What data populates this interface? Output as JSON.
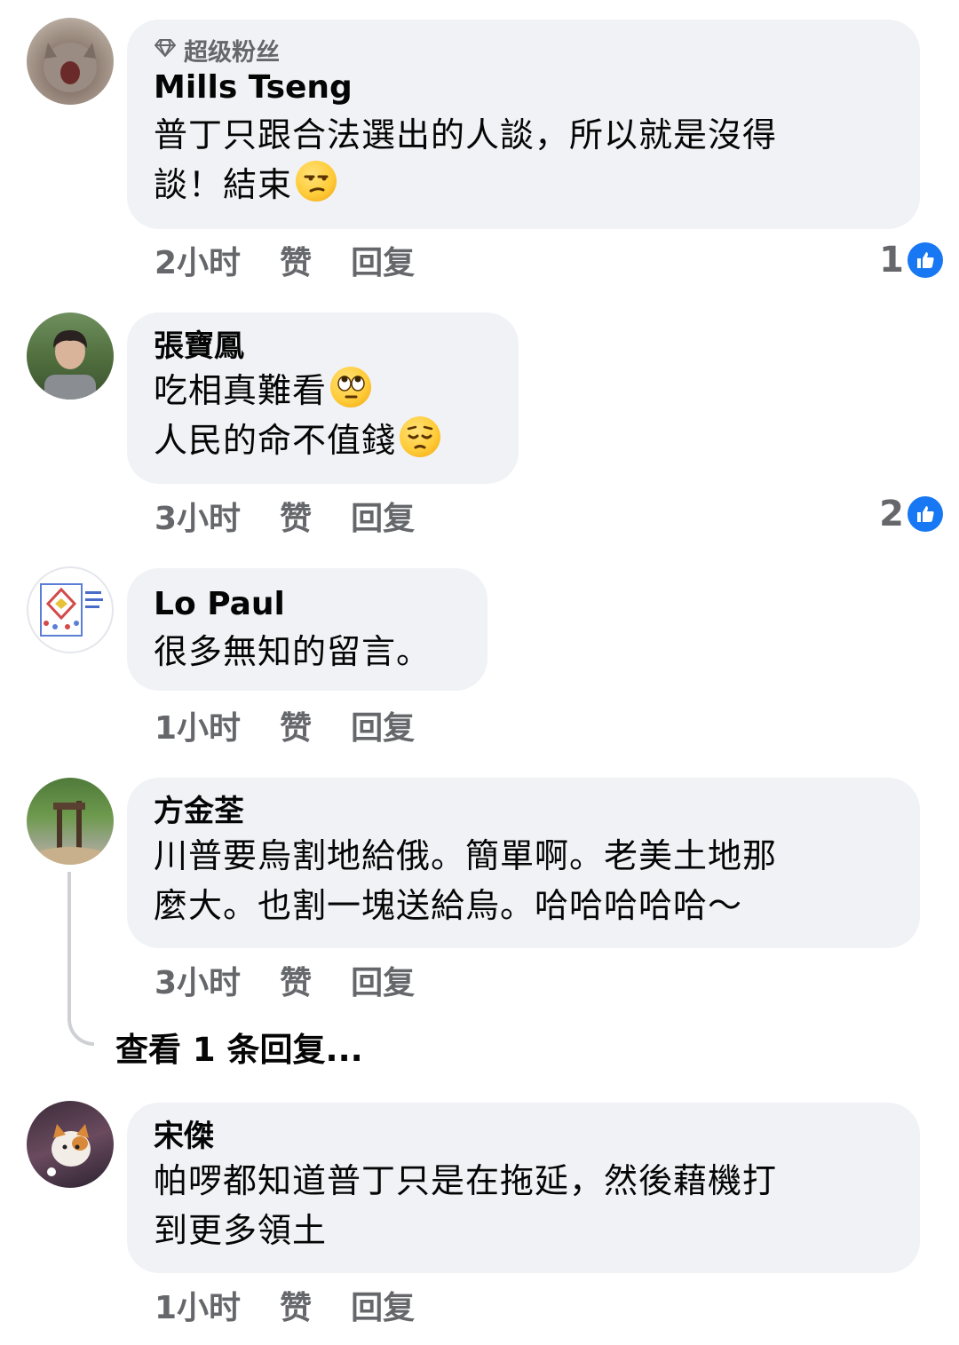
{
  "comments": [
    {
      "badge": "超级粉丝",
      "author": "Mills Tseng",
      "lines": [
        "普丁只跟合法選出的人談，所以就是沒得",
        "談！結束"
      ],
      "time": "2小时",
      "like_label": "赞",
      "reply_label": "回复",
      "like_count": "1"
    },
    {
      "author": "張寶鳳",
      "lines": [
        "吃相真難看",
        "人民的命不值錢"
      ],
      "time": "3小时",
      "like_label": "赞",
      "reply_label": "回复",
      "like_count": "2"
    },
    {
      "author": "Lo Paul",
      "lines": [
        "很多無知的留言。"
      ],
      "time": "1小时",
      "like_label": "赞",
      "reply_label": "回复"
    },
    {
      "author": "方金荃",
      "lines": [
        "川普要烏割地給俄。簡單啊。老美土地那",
        "麼大。也割一塊送給烏。哈哈哈哈哈～"
      ],
      "time": "3小时",
      "like_label": "赞",
      "reply_label": "回复",
      "view_replies": "查看 1 条回复..."
    },
    {
      "author": "宋傑",
      "lines": [
        "帕啰都知道普丁只是在拖延，然後藉機打",
        "到更多領土"
      ],
      "time": "1小时",
      "like_label": "赞",
      "reply_label": "回复"
    }
  ],
  "colors": {
    "bubble": "#f0f2f5",
    "meta_text": "#65676b",
    "like_blue": "#1877f2"
  }
}
